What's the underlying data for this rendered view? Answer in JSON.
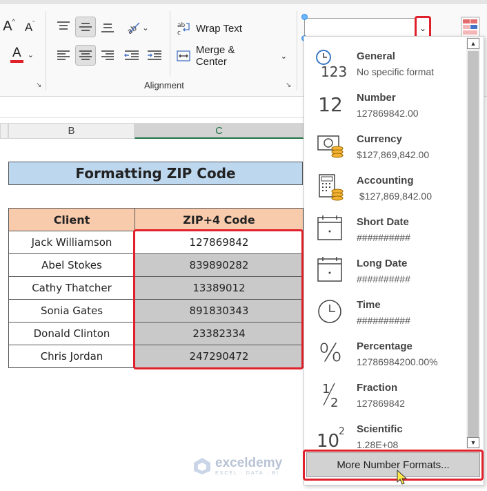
{
  "ribbon": {
    "font_grow": "A",
    "font_shrink": "A",
    "font_color": "A",
    "wrap_text": "Wrap Text",
    "merge_center": "Merge & Center",
    "alignment_label": "Alignment"
  },
  "columns": {
    "b": "B",
    "c": "C"
  },
  "sheet": {
    "title": "Formatting ZIP Code",
    "headers": {
      "client": "Client",
      "zip": "ZIP+4 Code"
    },
    "rows": [
      {
        "client": "Jack Williamson",
        "zip": "127869842"
      },
      {
        "client": "Abel Stokes",
        "zip": "839890282"
      },
      {
        "client": "Cathy Thatcher",
        "zip": "13389012"
      },
      {
        "client": "Sonia Gates",
        "zip": "891830343"
      },
      {
        "client": "Donald Clinton",
        "zip": "23382334"
      },
      {
        "client": "Chris Jordan",
        "zip": "247290472"
      }
    ]
  },
  "formats": [
    {
      "name": "General",
      "value": "No specific format",
      "icon": "clock-123-icon"
    },
    {
      "name": "Number",
      "value": "127869842.00",
      "icon": "number-12-icon"
    },
    {
      "name": "Currency",
      "value": "$127,869,842.00",
      "icon": "currency-icon"
    },
    {
      "name": "Accounting",
      "value": " $127,869,842.00",
      "icon": "accounting-icon"
    },
    {
      "name": "Short Date",
      "value": "##########",
      "icon": "calendar-icon"
    },
    {
      "name": "Long Date",
      "value": "##########",
      "icon": "calendar-icon"
    },
    {
      "name": "Time",
      "value": "##########",
      "icon": "clock-icon"
    },
    {
      "name": "Percentage",
      "value": "12786984200.00%",
      "icon": "percent-icon"
    },
    {
      "name": "Fraction",
      "value": "127869842",
      "icon": "fraction-icon"
    },
    {
      "name": "Scientific",
      "value": "1.28E+08",
      "icon": "scientific-icon"
    }
  ],
  "glyphs": {
    "n12": "12",
    "n123": "123",
    "pct": "%",
    "half_1": "1",
    "half_2": "2",
    "ten": "10",
    "sup2": "2"
  },
  "more_formats": "More Number Formats...",
  "watermark": {
    "brand": "exceldemy",
    "tagline": "EXCEL · DATA · BI"
  },
  "colors": {
    "accent_red": "#e0202a",
    "header_fill": "#f8cbad",
    "title_fill": "#bdd7ee",
    "zip_fill": "#c9c9c9"
  }
}
